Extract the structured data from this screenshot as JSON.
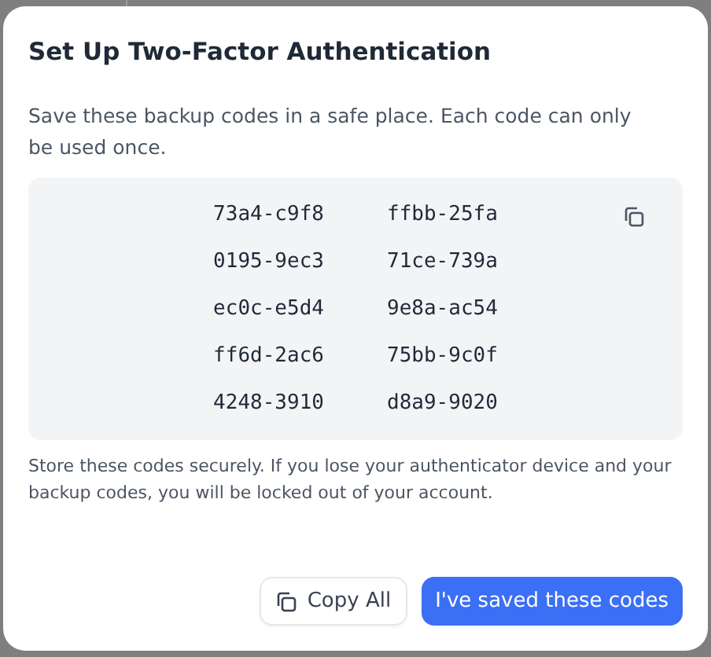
{
  "dialog": {
    "title": "Set Up Two-Factor Authentication",
    "description": "Save these backup codes in a safe place. Each code can only be used once.",
    "codes": [
      "73a4-c9f8",
      "ffbb-25fa",
      "0195-9ec3",
      "71ce-739a",
      "ec0c-e5d4",
      "9e8a-ac54",
      "ff6d-2ac6",
      "75bb-9c0f",
      "4248-3910",
      "d8a9-9020"
    ],
    "warning": "Store these codes securely. If you lose your authenticator device and your backup codes, you will be locked out of your account.",
    "buttons": [
      {
        "label": "Copy All",
        "kind": "secondary"
      },
      {
        "label": "I've saved these codes",
        "kind": "primary"
      }
    ]
  }
}
